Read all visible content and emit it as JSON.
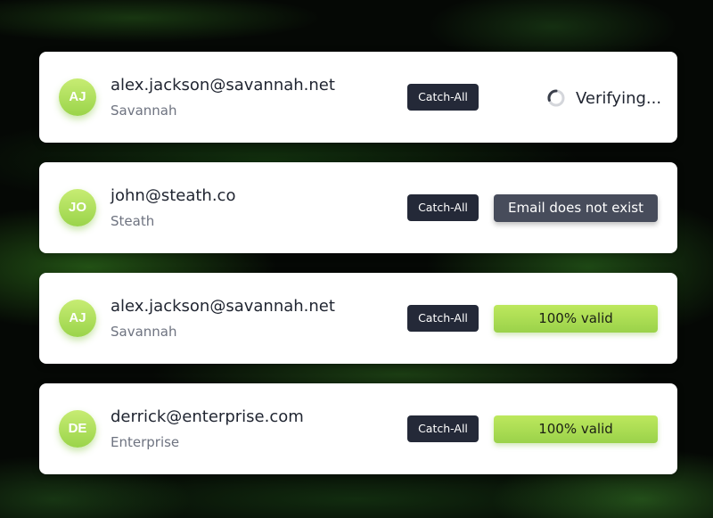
{
  "rows": [
    {
      "initials": "AJ",
      "email": "alex.jackson@savannah.net",
      "company": "Savannah",
      "tag": "Catch-All",
      "status": "Verifying...",
      "status_kind": "loading"
    },
    {
      "initials": "JO",
      "email": "john@steath.co",
      "company": "Steath",
      "tag": "Catch-All",
      "status": "Email does not exist",
      "status_kind": "invalid"
    },
    {
      "initials": "AJ",
      "email": "alex.jackson@savannah.net",
      "company": "Savannah",
      "tag": "Catch-All",
      "status": "100% valid",
      "status_kind": "valid"
    },
    {
      "initials": "DE",
      "email": "derrick@enterprise.com",
      "company": "Enterprise",
      "tag": "Catch-All",
      "status": "100% valid",
      "status_kind": "valid"
    }
  ],
  "colors": {
    "accent_green": "#a8dc52",
    "tag_dark": "#242938",
    "invalid_gray": "#474c5b",
    "card_bg": "#ffffff"
  },
  "icons": {
    "loading": "spinner-icon"
  }
}
